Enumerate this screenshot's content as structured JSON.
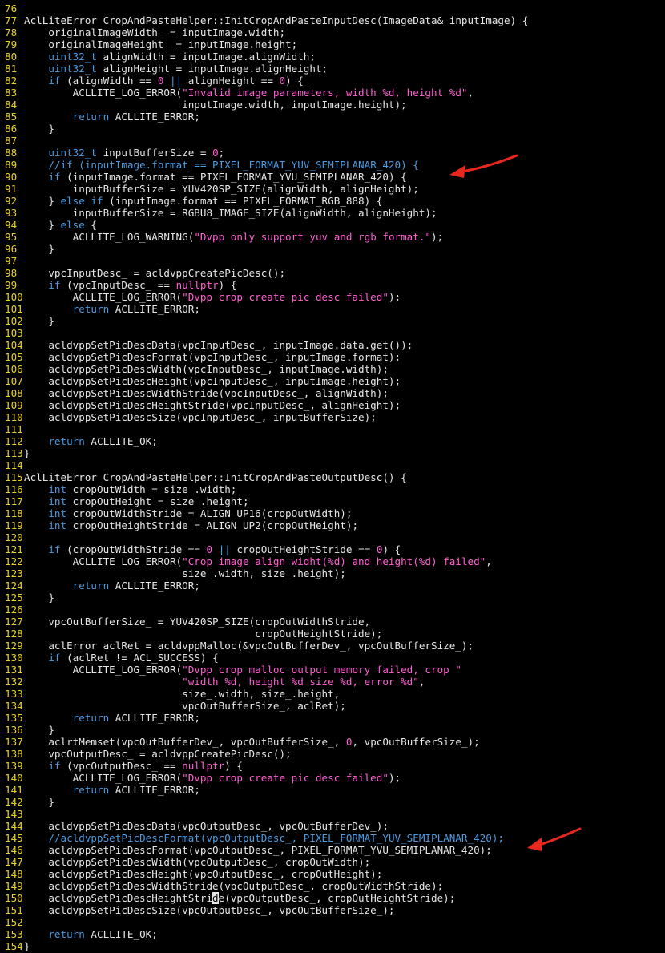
{
  "editor": {
    "colors": {
      "background": "#000000",
      "line_number": "#e8d22a",
      "plain": "#e6e6e6",
      "keyword": "#4a9be0",
      "string": "#ff5fd2",
      "comment": "#4a9be0",
      "annotation_arrow": "#e8281e"
    },
    "lines": [
      {
        "n": "76",
        "t": []
      },
      {
        "n": "77",
        "t": [
          [
            "p",
            "AclLiteError CropAndPasteHelper::InitCropAndPasteInputDesc(ImageData& inputImage) {"
          ]
        ]
      },
      {
        "n": "78",
        "t": [
          [
            "p",
            "    originalImageWidth_ = inputImage.width;"
          ]
        ]
      },
      {
        "n": "79",
        "t": [
          [
            "p",
            "    originalImageHeight_ = inputImage.height;"
          ]
        ]
      },
      {
        "n": "80",
        "t": [
          [
            "p",
            "    "
          ],
          [
            "k",
            "uint32_t"
          ],
          [
            "p",
            " alignWidth = inputImage.alignWidth;"
          ]
        ]
      },
      {
        "n": "81",
        "t": [
          [
            "p",
            "    "
          ],
          [
            "k",
            "uint32_t"
          ],
          [
            "p",
            " alignHeight = inputImage.alignHeight;"
          ]
        ]
      },
      {
        "n": "82",
        "t": [
          [
            "p",
            "    "
          ],
          [
            "k",
            "if"
          ],
          [
            "p",
            " (alignWidth == "
          ],
          [
            "n",
            "0"
          ],
          [
            "p",
            " "
          ],
          [
            "o",
            "||"
          ],
          [
            "p",
            " alignHeight == "
          ],
          [
            "n",
            "0"
          ],
          [
            "p",
            ") {"
          ]
        ]
      },
      {
        "n": "83",
        "t": [
          [
            "p",
            "        ACLLITE_LOG_ERROR("
          ],
          [
            "s",
            "\"Invalid image parameters, width %d, height %d\""
          ],
          [
            "p",
            ","
          ]
        ]
      },
      {
        "n": "84",
        "t": [
          [
            "p",
            "                          inputImage.width, inputImage.height);"
          ]
        ]
      },
      {
        "n": "85",
        "t": [
          [
            "p",
            "        "
          ],
          [
            "k",
            "return"
          ],
          [
            "p",
            " ACLLITE_ERROR;"
          ]
        ]
      },
      {
        "n": "86",
        "t": [
          [
            "p",
            "    }"
          ]
        ]
      },
      {
        "n": "87",
        "t": []
      },
      {
        "n": "88",
        "t": [
          [
            "p",
            "    "
          ],
          [
            "k",
            "uint32_t"
          ],
          [
            "p",
            " inputBufferSize = "
          ],
          [
            "n",
            "0"
          ],
          [
            "p",
            ";"
          ]
        ]
      },
      {
        "n": "89",
        "t": [
          [
            "p",
            "    "
          ],
          [
            "c",
            "//if (inputImage.format == PIXEL_FORMAT_YUV_SEMIPLANAR_420) {"
          ]
        ]
      },
      {
        "n": "90",
        "t": [
          [
            "p",
            "    "
          ],
          [
            "k",
            "if"
          ],
          [
            "p",
            " (inputImage.format == PIXEL_FORMAT_YVU_SEMIPLANAR_420) {"
          ]
        ]
      },
      {
        "n": "91",
        "t": [
          [
            "p",
            "        inputBufferSize = YUV420SP_SIZE(alignWidth, alignHeight);"
          ]
        ]
      },
      {
        "n": "92",
        "t": [
          [
            "p",
            "    } "
          ],
          [
            "k",
            "else if"
          ],
          [
            "p",
            " (inputImage.format == PIXEL_FORMAT_RGB_888) {"
          ]
        ]
      },
      {
        "n": "93",
        "t": [
          [
            "p",
            "        inputBufferSize = RGBU8_IMAGE_SIZE(alignWidth, alignHeight);"
          ]
        ]
      },
      {
        "n": "94",
        "t": [
          [
            "p",
            "    } "
          ],
          [
            "k",
            "else"
          ],
          [
            "p",
            " {"
          ]
        ]
      },
      {
        "n": "95",
        "t": [
          [
            "p",
            "        ACLLITE_LOG_WARNING("
          ],
          [
            "s",
            "\"Dvpp only support yuv and rgb format.\""
          ],
          [
            "p",
            ");"
          ]
        ]
      },
      {
        "n": "96",
        "t": [
          [
            "p",
            "    }"
          ]
        ]
      },
      {
        "n": "97",
        "t": []
      },
      {
        "n": "98",
        "t": [
          [
            "p",
            "    vpcInputDesc_ = acldvppCreatePicDesc();"
          ]
        ]
      },
      {
        "n": "99",
        "t": [
          [
            "p",
            "    "
          ],
          [
            "k",
            "if"
          ],
          [
            "p",
            " (vpcInputDesc_ == "
          ],
          [
            "s",
            "nullptr"
          ],
          [
            "p",
            ") {"
          ]
        ]
      },
      {
        "n": "100",
        "t": [
          [
            "p",
            "        ACLLITE_LOG_ERROR("
          ],
          [
            "s",
            "\"Dvpp crop create pic desc failed\""
          ],
          [
            "p",
            ");"
          ]
        ]
      },
      {
        "n": "101",
        "t": [
          [
            "p",
            "        "
          ],
          [
            "k",
            "return"
          ],
          [
            "p",
            " ACLLITE_ERROR;"
          ]
        ]
      },
      {
        "n": "102",
        "t": [
          [
            "p",
            "    }"
          ]
        ]
      },
      {
        "n": "103",
        "t": []
      },
      {
        "n": "104",
        "t": [
          [
            "p",
            "    acldvppSetPicDescData(vpcInputDesc_, inputImage.data.get());"
          ]
        ]
      },
      {
        "n": "105",
        "t": [
          [
            "p",
            "    acldvppSetPicDescFormat(vpcInputDesc_, inputImage.format);"
          ]
        ]
      },
      {
        "n": "106",
        "t": [
          [
            "p",
            "    acldvppSetPicDescWidth(vpcInputDesc_, inputImage.width);"
          ]
        ]
      },
      {
        "n": "107",
        "t": [
          [
            "p",
            "    acldvppSetPicDescHeight(vpcInputDesc_, inputImage.height);"
          ]
        ]
      },
      {
        "n": "108",
        "t": [
          [
            "p",
            "    acldvppSetPicDescWidthStride(vpcInputDesc_, alignWidth);"
          ]
        ]
      },
      {
        "n": "109",
        "t": [
          [
            "p",
            "    acldvppSetPicDescHeightStride(vpcInputDesc_, alignHeight);"
          ]
        ]
      },
      {
        "n": "110",
        "t": [
          [
            "p",
            "    acldvppSetPicDescSize(vpcInputDesc_, inputBufferSize);"
          ]
        ]
      },
      {
        "n": "111",
        "t": []
      },
      {
        "n": "112",
        "t": [
          [
            "p",
            "    "
          ],
          [
            "k",
            "return"
          ],
          [
            "p",
            " ACLLITE_OK;"
          ]
        ]
      },
      {
        "n": "113",
        "t": [
          [
            "p",
            "}"
          ]
        ]
      },
      {
        "n": "114",
        "t": []
      },
      {
        "n": "115",
        "t": [
          [
            "p",
            "AclLiteError CropAndPasteHelper::InitCropAndPasteOutputDesc() {"
          ]
        ]
      },
      {
        "n": "116",
        "t": [
          [
            "p",
            "    "
          ],
          [
            "k",
            "int"
          ],
          [
            "p",
            " cropOutWidth = size_.width;"
          ]
        ]
      },
      {
        "n": "117",
        "t": [
          [
            "p",
            "    "
          ],
          [
            "k",
            "int"
          ],
          [
            "p",
            " cropOutHeight = size_.height;"
          ]
        ]
      },
      {
        "n": "118",
        "t": [
          [
            "p",
            "    "
          ],
          [
            "k",
            "int"
          ],
          [
            "p",
            " cropOutWidthStride = ALIGN_UP16(cropOutWidth);"
          ]
        ]
      },
      {
        "n": "119",
        "t": [
          [
            "p",
            "    "
          ],
          [
            "k",
            "int"
          ],
          [
            "p",
            " cropOutHeightStride = ALIGN_UP2(cropOutHeight);"
          ]
        ]
      },
      {
        "n": "120",
        "t": []
      },
      {
        "n": "121",
        "t": [
          [
            "p",
            "    "
          ],
          [
            "k",
            "if"
          ],
          [
            "p",
            " (cropOutWidthStride == "
          ],
          [
            "n",
            "0"
          ],
          [
            "p",
            " "
          ],
          [
            "o",
            "||"
          ],
          [
            "p",
            " cropOutHeightStride == "
          ],
          [
            "n",
            "0"
          ],
          [
            "p",
            ") {"
          ]
        ]
      },
      {
        "n": "122",
        "t": [
          [
            "p",
            "        ACLLITE_LOG_ERROR("
          ],
          [
            "s",
            "\"Crop image align widht(%d) and height(%d) failed\""
          ],
          [
            "p",
            ","
          ]
        ]
      },
      {
        "n": "123",
        "t": [
          [
            "p",
            "                          size_.width, size_.height);"
          ]
        ]
      },
      {
        "n": "124",
        "t": [
          [
            "p",
            "        "
          ],
          [
            "k",
            "return"
          ],
          [
            "p",
            " ACLLITE_ERROR;"
          ]
        ]
      },
      {
        "n": "125",
        "t": [
          [
            "p",
            "    }"
          ]
        ]
      },
      {
        "n": "126",
        "t": []
      },
      {
        "n": "127",
        "t": [
          [
            "p",
            "    vpcOutBufferSize_ = YUV420SP_SIZE(cropOutWidthStride,"
          ]
        ]
      },
      {
        "n": "128",
        "t": [
          [
            "p",
            "                                      cropOutHeightStride);"
          ]
        ]
      },
      {
        "n": "129",
        "t": [
          [
            "p",
            "    aclError aclRet = acldvppMalloc(&vpcOutBufferDev_, vpcOutBufferSize_);"
          ]
        ]
      },
      {
        "n": "130",
        "t": [
          [
            "p",
            "    "
          ],
          [
            "k",
            "if"
          ],
          [
            "p",
            " (aclRet != ACL_SUCCESS) {"
          ]
        ]
      },
      {
        "n": "131",
        "t": [
          [
            "p",
            "        ACLLITE_LOG_ERROR("
          ],
          [
            "s",
            "\"Dvpp crop malloc output memory failed, crop \""
          ]
        ]
      },
      {
        "n": "132",
        "t": [
          [
            "p",
            "                          "
          ],
          [
            "s",
            "\"width %d, height %d size %d, error %d\""
          ],
          [
            "p",
            ","
          ]
        ]
      },
      {
        "n": "133",
        "t": [
          [
            "p",
            "                          size_.width, size_.height,"
          ]
        ]
      },
      {
        "n": "134",
        "t": [
          [
            "p",
            "                          vpcOutBufferSize_, aclRet);"
          ]
        ]
      },
      {
        "n": "135",
        "t": [
          [
            "p",
            "        "
          ],
          [
            "k",
            "return"
          ],
          [
            "p",
            " ACLLITE_ERROR;"
          ]
        ]
      },
      {
        "n": "136",
        "t": [
          [
            "p",
            "    }"
          ]
        ]
      },
      {
        "n": "137",
        "t": [
          [
            "p",
            "    aclrtMemset(vpcOutBufferDev_, vpcOutBufferSize_, "
          ],
          [
            "n",
            "0"
          ],
          [
            "p",
            ", vpcOutBufferSize_);"
          ]
        ]
      },
      {
        "n": "138",
        "t": [
          [
            "p",
            "    vpcOutputDesc_ = acldvppCreatePicDesc();"
          ]
        ]
      },
      {
        "n": "139",
        "t": [
          [
            "p",
            "    "
          ],
          [
            "k",
            "if"
          ],
          [
            "p",
            " (vpcOutputDesc_ == "
          ],
          [
            "s",
            "nullptr"
          ],
          [
            "p",
            ") {"
          ]
        ]
      },
      {
        "n": "140",
        "t": [
          [
            "p",
            "        ACLLITE_LOG_ERROR("
          ],
          [
            "s",
            "\"Dvpp crop create pic desc failed\""
          ],
          [
            "p",
            ");"
          ]
        ]
      },
      {
        "n": "141",
        "t": [
          [
            "p",
            "        "
          ],
          [
            "k",
            "return"
          ],
          [
            "p",
            " ACLLITE_ERROR;"
          ]
        ]
      },
      {
        "n": "142",
        "t": [
          [
            "p",
            "    }"
          ]
        ]
      },
      {
        "n": "143",
        "t": []
      },
      {
        "n": "144",
        "t": [
          [
            "p",
            "    acldvppSetPicDescData(vpcOutputDesc_, vpcOutBufferDev_);"
          ]
        ]
      },
      {
        "n": "145",
        "t": [
          [
            "p",
            "    "
          ],
          [
            "c",
            "//acldvppSetPicDescFormat(vpcOutputDesc_, PIXEL_FORMAT_YUV_SEMIPLANAR_420);"
          ]
        ]
      },
      {
        "n": "146",
        "t": [
          [
            "p",
            "    acldvppSetPicDescFormat(vpcOutputDesc_, PIXEL_FORMAT_YVU_SEMIPLANAR_420);"
          ]
        ]
      },
      {
        "n": "147",
        "t": [
          [
            "p",
            "    acldvppSetPicDescWidth(vpcOutputDesc_, cropOutWidth);"
          ]
        ]
      },
      {
        "n": "148",
        "t": [
          [
            "p",
            "    acldvppSetPicDescHeight(vpcOutputDesc_, cropOutHeight);"
          ]
        ]
      },
      {
        "n": "149",
        "t": [
          [
            "p",
            "    acldvppSetPicDescWidthStride(vpcOutputDesc_, cropOutWidthStride);"
          ]
        ]
      },
      {
        "n": "150",
        "t": [
          [
            "p",
            "    acldvppSetPicDescHeightStri"
          ],
          [
            "x",
            "d"
          ],
          [
            "p",
            "e(vpcOutputDesc_, cropOutHeightStride);"
          ]
        ]
      },
      {
        "n": "151",
        "t": [
          [
            "p",
            "    acldvppSetPicDescSize(vpcOutputDesc_, vpcOutBufferSize_);"
          ]
        ]
      },
      {
        "n": "152",
        "t": []
      },
      {
        "n": "153",
        "t": [
          [
            "p",
            "    "
          ],
          [
            "k",
            "return"
          ],
          [
            "p",
            " ACLLITE_OK;"
          ]
        ]
      },
      {
        "n": "154",
        "t": [
          [
            "p",
            "}"
          ]
        ]
      }
    ]
  }
}
